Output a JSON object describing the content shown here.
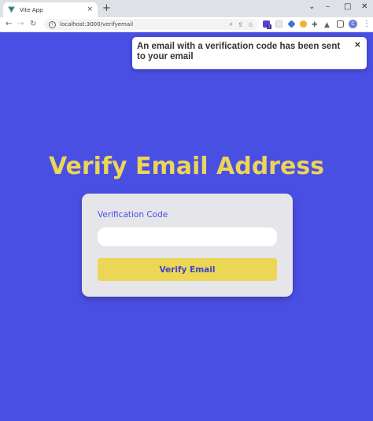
{
  "browser": {
    "tab_title": "Vite App",
    "tab_close": "×",
    "new_tab": "+",
    "url": "localhost:3000/verifyemail",
    "profile_initial": "C",
    "ext_badge": "1",
    "window_controls": {
      "chevron": "⌄",
      "minimize": "–",
      "maximize": "□",
      "close": "✕"
    }
  },
  "colors": {
    "background": "#4a4fe4",
    "accent_yellow": "#ecd655",
    "card": "#e5e5ea"
  },
  "toast": {
    "message": "An email with a verification code has been sent to your email",
    "close_label": "×"
  },
  "page": {
    "title": "Verify Email Address"
  },
  "form": {
    "code_label": "Verification Code",
    "code_value": "",
    "submit_label": "Verify Email"
  }
}
